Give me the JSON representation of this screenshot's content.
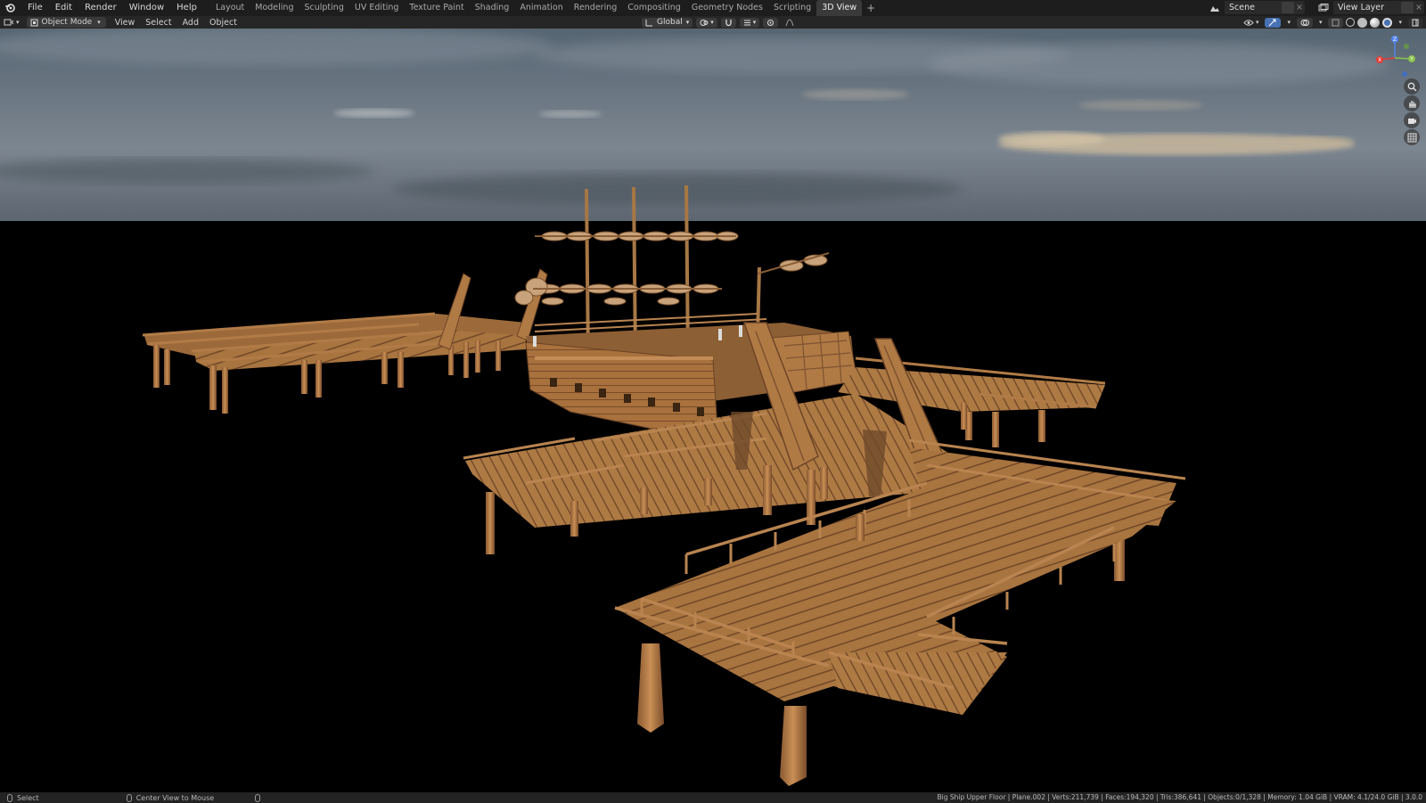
{
  "topbar": {
    "menu": [
      "File",
      "Edit",
      "Render",
      "Window",
      "Help"
    ],
    "workspaces": [
      "Layout",
      "Modeling",
      "Sculpting",
      "UV Editing",
      "Texture Paint",
      "Shading",
      "Animation",
      "Rendering",
      "Compositing",
      "Geometry Nodes",
      "Scripting",
      "3D View"
    ],
    "active_workspace": "3D View",
    "add_tab": "+",
    "scene_label": "Scene",
    "view_layer_label": "View Layer"
  },
  "header": {
    "mode": "Object Mode",
    "menus": [
      "View",
      "Select",
      "Add",
      "Object"
    ],
    "orientation": "Global"
  },
  "viewport": {
    "icons": [
      "axis-gizmo",
      "zoom-icon",
      "hand-pan-icon",
      "camera-icon",
      "grid-perspective-icon"
    ],
    "gizmo_axes": {
      "z": "Z",
      "y": "Y",
      "x": "X"
    }
  },
  "statusbar": {
    "left_action": "Select",
    "middle_action": "Center View to Mouse",
    "stats": "Big Ship Upper Floor | Plane.002 | Verts:211,739 | Faces:194,320 | Tris:386,641 | Objects:0/1,328 | Memory: 1.04 GiB | VRAM: 4.1/24.0 GiB | 3.0.0"
  },
  "colors": {
    "wood": "#b07a45",
    "wood_dark": "#6e4526",
    "wood_light": "#d8a86f",
    "accent_blue": "#4772b3",
    "topbar": "#1d1d1d",
    "header": "#262626"
  }
}
